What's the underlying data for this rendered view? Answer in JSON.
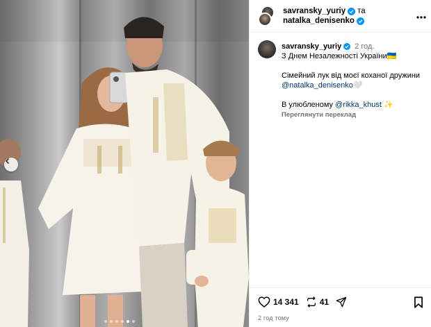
{
  "header": {
    "user1": "savransky_yuriy",
    "joiner": "та",
    "user2": "natalka_denisenko",
    "more_icon": "more-horizontal-icon"
  },
  "caption": {
    "username": "savransky_yuriy",
    "time": "2 год.",
    "line1": "З Днем Незалежності України",
    "line1_emoji": "🇺🇦",
    "line2_text": "Сімейний лук від моєї коханої дружини",
    "line2_mention": "@natalka_denisenko",
    "line2_emoji": "🤍",
    "line3_text": "В улюбленому",
    "line3_mention": "@rikka_khust",
    "line3_emoji": "✨",
    "translate": "Переглянути переклад"
  },
  "actions": {
    "likes": "14 341",
    "reposts": "41",
    "date": "2 год тому"
  },
  "carousel": {
    "total": 6,
    "active": 5
  },
  "colors": {
    "verified": "#0095f6",
    "mention": "#00376b",
    "muted": "#737373"
  }
}
